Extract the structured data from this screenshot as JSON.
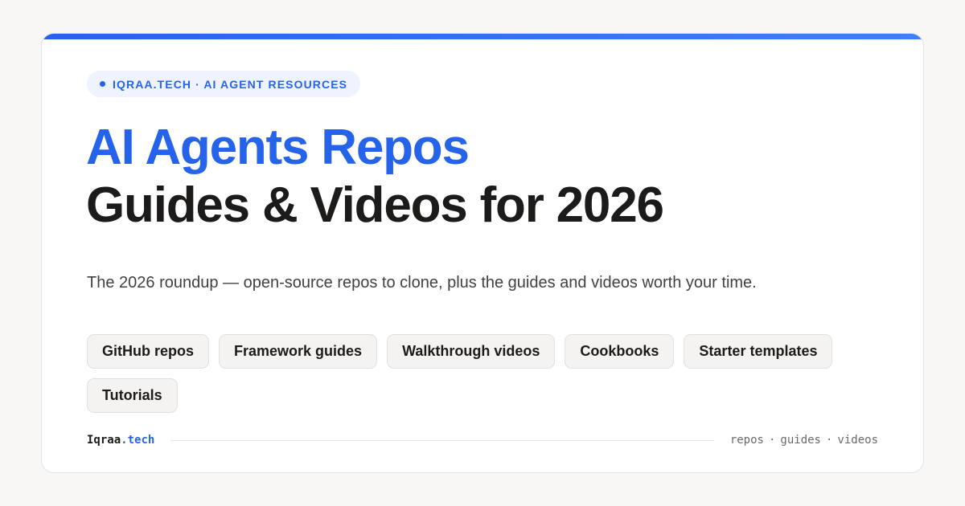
{
  "colors": {
    "accent": "#2563eb",
    "text": "#1c1b19",
    "muted": "#6e6a64",
    "background": "#f8f7f5",
    "card": "#ffffff"
  },
  "badge": {
    "text": "IQRAA.TECH · AI AGENT RESOURCES",
    "icon": "dot-icon"
  },
  "title": {
    "line1": "AI Agents Repos",
    "line2": "Guides & Videos for 2026"
  },
  "subtitle": "The 2026 roundup — open-source repos to clone, plus the guides and videos worth your time.",
  "chips": [
    "GitHub repos",
    "Framework guides",
    "Walkthrough videos",
    "Cookbooks",
    "Starter templates",
    "Tutorials"
  ],
  "footer": {
    "brand_name": "Iqraa",
    "brand_dot": ".",
    "brand_tld": "tech",
    "tags": [
      "repos",
      "guides",
      "videos"
    ],
    "separator": "·"
  }
}
